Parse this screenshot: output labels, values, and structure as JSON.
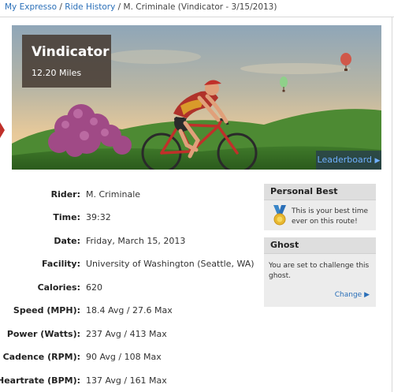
{
  "breadcrumb": {
    "home": "My Expresso",
    "history": "Ride History",
    "current": "M. Criminale (Vindicator - 3/15/2013)"
  },
  "hero": {
    "title": "Vindicator",
    "distance": "12.20 Miles",
    "leaderboard": "Leaderboard"
  },
  "details": {
    "rider": {
      "label": "Rider:",
      "value": "M. Criminale"
    },
    "time": {
      "label": "Time:",
      "value": "39:32"
    },
    "date": {
      "label": "Date:",
      "value": "Friday, March 15, 2013"
    },
    "facility": {
      "label": "Facility:",
      "value": "University of Washington (Seattle, WA)"
    },
    "calories": {
      "label": "Calories:",
      "value": "620"
    },
    "speed": {
      "label": "Speed (MPH):",
      "value": "18.4 Avg / 27.6 Max"
    },
    "power": {
      "label": "Power (Watts):",
      "value": "237 Avg / 413 Max"
    },
    "cadence": {
      "label": "Cadence (RPM):",
      "value": "90 Avg / 108 Max"
    },
    "heartrate": {
      "label": "Heartrate (BPM):",
      "value": "137 Avg / 161 Max"
    }
  },
  "personal_best": {
    "header": "Personal Best",
    "text": "This is your best time ever on this route!"
  },
  "ghost": {
    "header": "Ghost",
    "text": "You are set to challenge this ghost.",
    "change": "Change"
  },
  "colors": {
    "link": "#2a6fb8",
    "panel_bg": "#ececec"
  }
}
